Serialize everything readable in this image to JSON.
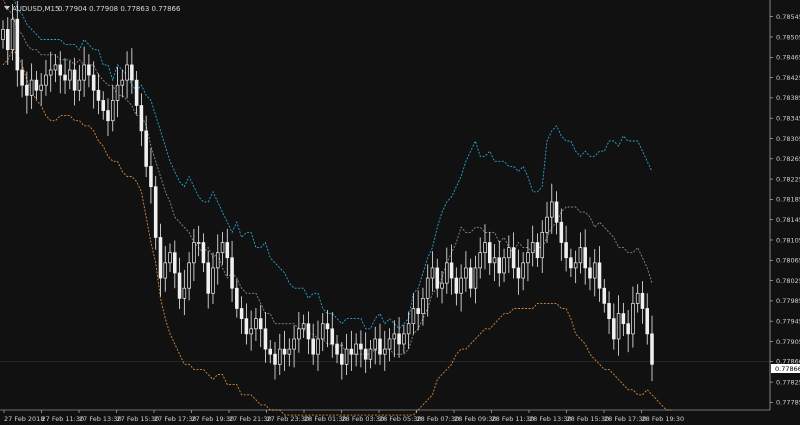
{
  "header": {
    "symbol": "AUDUSD,M15",
    "quotes": "0.77904 0.77908 0.77863 0.77866"
  },
  "current_price": "0.77866",
  "colors": {
    "background": "#111111",
    "candle": "#f0f0f0",
    "band_outer_upper": "#2aa6d6",
    "band_inner_upper": "#8a8a8a",
    "band_lower": "#d98a3a",
    "grid_line": "#333333",
    "price_label_bg": "#ffffff"
  },
  "chart_data": {
    "type": "candlestick",
    "title": "AUDUSD,M15",
    "ylim": [
      0.7777,
      0.7857
    ],
    "y_ticks": [
      "0.78545",
      "0.78505",
      "0.78465",
      "0.78425",
      "0.78385",
      "0.78345",
      "0.78305",
      "0.78265",
      "0.78225",
      "0.78185",
      "0.78145",
      "0.78105",
      "0.78065",
      "0.78025",
      "0.77985",
      "0.77945",
      "0.77905",
      "0.77866",
      "0.77825",
      "0.77785"
    ],
    "x_ticks": [
      "27 Feb 2018",
      "27 Feb 11:30",
      "27 Feb 13:30",
      "27 Feb 15:30",
      "27 Feb 17:30",
      "27 Feb 19:30",
      "27 Feb 21:30",
      "27 Feb 23:30",
      "28 Feb 01:30",
      "28 Feb 03:30",
      "28 Feb 05:30",
      "28 Feb 07:30",
      "28 Feb 09:30",
      "28 Feb 11:30",
      "28 Feb 13:30",
      "28 Feb 15:30",
      "28 Feb 17:30",
      "28 Feb 19:30"
    ],
    "candles": {
      "close": [
        0.7852,
        0.7848,
        0.7854,
        0.7844,
        0.7841,
        0.7839,
        0.7842,
        0.784,
        0.7841,
        0.7843,
        0.7844,
        0.7845,
        0.7843,
        0.7842,
        0.7844,
        0.784,
        0.7842,
        0.7845,
        0.7843,
        0.784,
        0.7838,
        0.7836,
        0.7834,
        0.7838,
        0.7841,
        0.7842,
        0.7845,
        0.7842,
        0.7837,
        0.7832,
        0.7825,
        0.7821,
        0.7811,
        0.7803,
        0.7806,
        0.7808,
        0.7804,
        0.7799,
        0.7801,
        0.7806,
        0.781,
        0.781,
        0.7806,
        0.78,
        0.7805,
        0.7808,
        0.781,
        0.7807,
        0.7801,
        0.7797,
        0.7795,
        0.7792,
        0.7793,
        0.7795,
        0.7793,
        0.7789,
        0.7788,
        0.7786,
        0.7789,
        0.7788,
        0.7789,
        0.7791,
        0.7793,
        0.7794,
        0.7791,
        0.7788,
        0.7791,
        0.7794,
        0.7793,
        0.779,
        0.7788,
        0.7786,
        0.7789,
        0.7788,
        0.779,
        0.7789,
        0.7787,
        0.7789,
        0.7791,
        0.7788,
        0.7789,
        0.7791,
        0.7792,
        0.779,
        0.7792,
        0.7794,
        0.7797,
        0.7796,
        0.7799,
        0.7803,
        0.7805,
        0.7801,
        0.7802,
        0.7806,
        0.7803,
        0.78,
        0.7803,
        0.7805,
        0.7801,
        0.7805,
        0.7808,
        0.781,
        0.7806,
        0.7807,
        0.7804,
        0.7807,
        0.7809,
        0.7805,
        0.7803,
        0.7806,
        0.7808,
        0.781,
        0.7807,
        0.7812,
        0.7815,
        0.7818,
        0.7814,
        0.781,
        0.7807,
        0.7805,
        0.7806,
        0.7809,
        0.7805,
        0.7803,
        0.7806,
        0.7801,
        0.7798,
        0.7795,
        0.7791,
        0.7796,
        0.7794,
        0.7792,
        0.7798,
        0.78,
        0.7797,
        0.7792,
        0.7786
      ]
    },
    "bands": {
      "outer_upper": [
        0.7861,
        0.7861,
        0.7859,
        0.7856,
        0.7855,
        0.7853,
        0.7852,
        0.7851,
        0.785,
        0.785,
        0.785,
        0.785,
        0.785,
        0.7849,
        0.7849,
        0.7849,
        0.7848,
        0.785,
        0.7849,
        0.7848,
        0.7848,
        0.7845,
        0.7845,
        0.7842,
        0.7845,
        0.7844,
        0.7843,
        0.7841,
        0.784,
        0.7841,
        0.7839,
        0.7838,
        0.7835,
        0.7832,
        0.7829,
        0.7826,
        0.7824,
        0.7822,
        0.7821,
        0.7823,
        0.7821,
        0.7819,
        0.7818,
        0.7818,
        0.782,
        0.7818,
        0.7816,
        0.7814,
        0.7812,
        0.7814,
        0.7811,
        0.7812,
        0.7812,
        0.7809,
        0.7809,
        0.781,
        0.7807,
        0.7806,
        0.7805,
        0.7804,
        0.7802,
        0.7801,
        0.7801,
        0.7801,
        0.7799,
        0.78,
        0.78,
        0.7797,
        0.7796,
        0.7796,
        0.7795,
        0.7794,
        0.7795,
        0.7795,
        0.7795,
        0.7795,
        0.7793,
        0.7793,
        0.7795,
        0.7796,
        0.7794,
        0.7795,
        0.7794,
        0.7793,
        0.7794,
        0.7795,
        0.78,
        0.7801,
        0.7804,
        0.7807,
        0.7809,
        0.7813,
        0.7816,
        0.7818,
        0.7819,
        0.7821,
        0.7823,
        0.7826,
        0.7828,
        0.783,
        0.7827,
        0.7827,
        0.7828,
        0.7826,
        0.7826,
        0.7826,
        0.7825,
        0.7825,
        0.7824,
        0.7825,
        0.7823,
        0.782,
        0.782,
        0.7821,
        0.783,
        0.7832,
        0.7833,
        0.7831,
        0.783,
        0.783,
        0.7828,
        0.7827,
        0.7828,
        0.7827,
        0.7827,
        0.7828,
        0.7828,
        0.783,
        0.783,
        0.7829,
        0.7831,
        0.783,
        0.783,
        0.783,
        0.7828,
        0.7826,
        0.7824
      ],
      "inner_upper": [
        0.7858,
        0.7856,
        0.7855,
        0.7852,
        0.7851,
        0.7849,
        0.7848,
        0.7848,
        0.7847,
        0.7847,
        0.7847,
        0.7847,
        0.7846,
        0.7846,
        0.7846,
        0.7845,
        0.7846,
        0.7845,
        0.7845,
        0.7845,
        0.7843,
        0.7842,
        0.7841,
        0.7841,
        0.7839,
        0.7839,
        0.7838,
        0.7837,
        0.7835,
        0.7835,
        0.7833,
        0.7829,
        0.7826,
        0.7823,
        0.782,
        0.7818,
        0.7815,
        0.7814,
        0.7813,
        0.7812,
        0.781,
        0.7809,
        0.7808,
        0.7809,
        0.7807,
        0.7808,
        0.7805,
        0.7803,
        0.7804,
        0.7803,
        0.7801,
        0.78,
        0.78,
        0.78,
        0.7798,
        0.7796,
        0.7796,
        0.7794,
        0.7794,
        0.7794,
        0.7794,
        0.7794,
        0.7793,
        0.7793,
        0.7792,
        0.7792,
        0.7791,
        0.7791,
        0.779,
        0.779,
        0.7789,
        0.779,
        0.7788,
        0.7788,
        0.7788,
        0.7788,
        0.7788,
        0.7788,
        0.7789,
        0.7788,
        0.7789,
        0.7789,
        0.7788,
        0.7788,
        0.7788,
        0.7789,
        0.7792,
        0.7793,
        0.7795,
        0.7797,
        0.78,
        0.7801,
        0.7803,
        0.7806,
        0.7808,
        0.781,
        0.7813,
        0.7812,
        0.7812,
        0.7813,
        0.7813,
        0.7812,
        0.7812,
        0.7812,
        0.781,
        0.7811,
        0.7809,
        0.7808,
        0.781,
        0.7809,
        0.7809,
        0.7808,
        0.7809,
        0.7809,
        0.7811,
        0.7813,
        0.7814,
        0.7816,
        0.7817,
        0.7817,
        0.7817,
        0.7816,
        0.7816,
        0.7815,
        0.7813,
        0.7814,
        0.7813,
        0.7812,
        0.7811,
        0.7809,
        0.7809,
        0.7808,
        0.7808,
        0.7809,
        0.7807,
        0.7805,
        0.7802
      ],
      "lower": [
        0.7845,
        0.7846,
        0.7848,
        0.7847,
        0.7845,
        0.7842,
        0.784,
        0.7838,
        0.7837,
        0.7835,
        0.7834,
        0.7834,
        0.7835,
        0.7835,
        0.7835,
        0.7834,
        0.7834,
        0.7833,
        0.7833,
        0.7832,
        0.783,
        0.7829,
        0.7827,
        0.7826,
        0.7826,
        0.7824,
        0.7823,
        0.7823,
        0.7822,
        0.782,
        0.7815,
        0.781,
        0.7806,
        0.7799,
        0.7795,
        0.7792,
        0.779,
        0.7788,
        0.7786,
        0.7786,
        0.7785,
        0.7785,
        0.7785,
        0.7784,
        0.7783,
        0.7784,
        0.7784,
        0.7782,
        0.7782,
        0.7782,
        0.778,
        0.778,
        0.778,
        0.7779,
        0.7778,
        0.7778,
        0.7777,
        0.7777,
        0.7777,
        0.7776,
        0.7776,
        0.7776,
        0.7776,
        0.7776,
        0.7776,
        0.7776,
        0.7776,
        0.7776,
        0.7776,
        0.7776,
        0.7776,
        0.7776,
        0.7776,
        0.7776,
        0.7776,
        0.7776,
        0.7776,
        0.7776,
        0.7776,
        0.7776,
        0.7776,
        0.7776,
        0.7776,
        0.7776,
        0.7776,
        0.7776,
        0.7776,
        0.7777,
        0.7778,
        0.7779,
        0.778,
        0.7783,
        0.7784,
        0.7785,
        0.7786,
        0.7788,
        0.7789,
        0.7789,
        0.779,
        0.7791,
        0.7792,
        0.7793,
        0.7793,
        0.7794,
        0.7795,
        0.7796,
        0.7796,
        0.7797,
        0.7797,
        0.7797,
        0.7797,
        0.7797,
        0.7798,
        0.7798,
        0.7798,
        0.7798,
        0.7798,
        0.7797,
        0.7797,
        0.7795,
        0.7792,
        0.7791,
        0.779,
        0.7788,
        0.7787,
        0.7786,
        0.7785,
        0.7785,
        0.7784,
        0.7783,
        0.7782,
        0.7781,
        0.7781,
        0.778,
        0.778,
        0.7781,
        0.778,
        0.7779,
        0.7778,
        0.7777,
        0.7777
      ]
    }
  }
}
